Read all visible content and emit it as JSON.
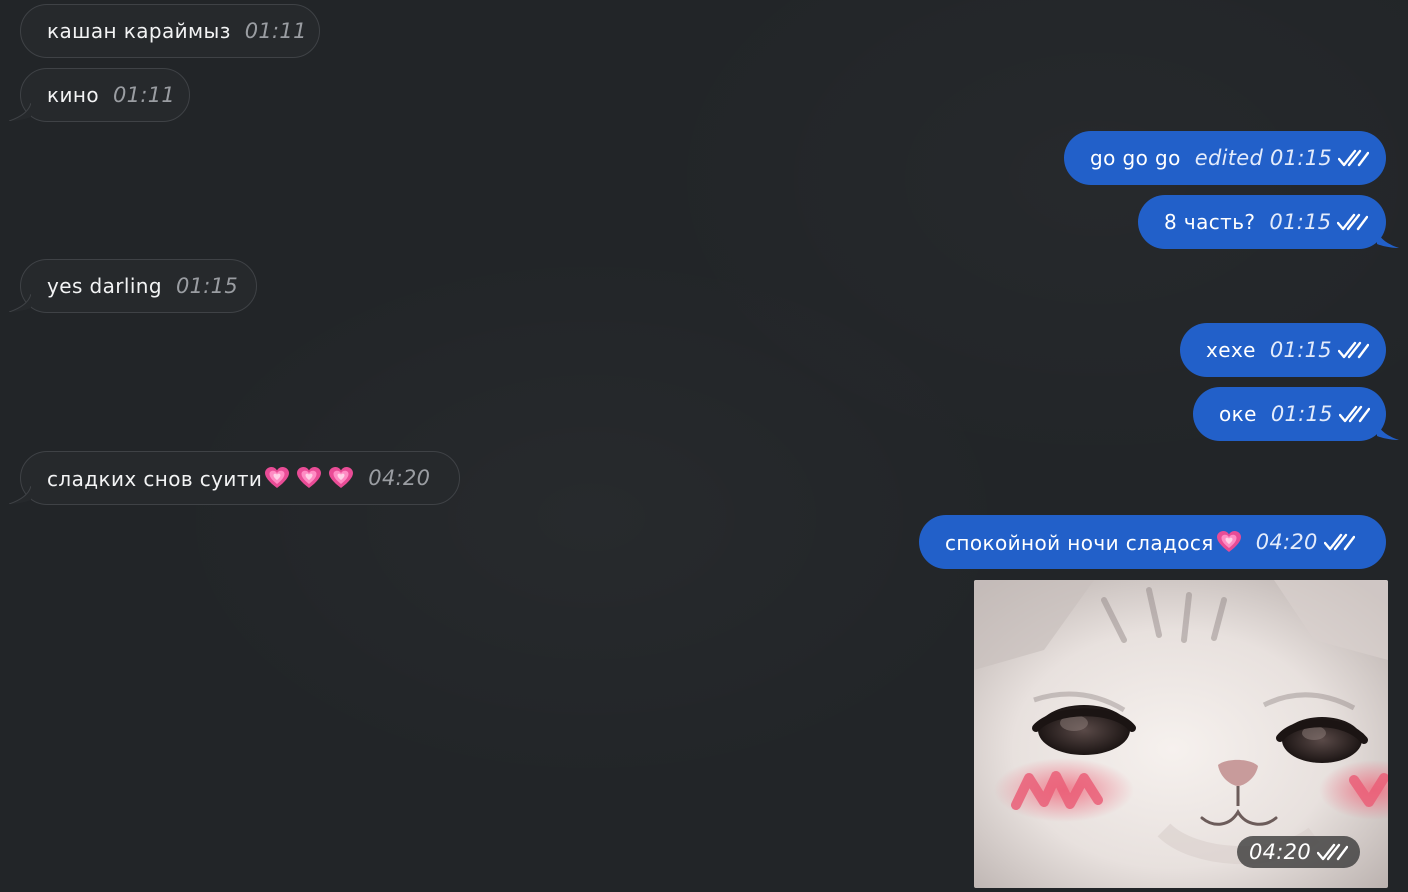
{
  "messages": [
    {
      "text": "кашан караймыз",
      "time": "01:11"
    },
    {
      "text": "кино",
      "time": "01:11"
    },
    {
      "text": "go go go",
      "time": "edited 01:15"
    },
    {
      "text": "8 часть?",
      "time": "01:15"
    },
    {
      "text": "yes darling",
      "time": "01:15"
    },
    {
      "text": "хехе",
      "time": "01:15"
    },
    {
      "text": "оке",
      "time": "01:15"
    },
    {
      "text": "сладких снов суити",
      "time": "04:20"
    },
    {
      "text": "спокойной ночи сладося",
      "time": "04:20"
    }
  ],
  "sticker": {
    "time": "04:20"
  },
  "icons": {
    "read_receipt": "double-check-icon",
    "emoji": "growing-heart-icon"
  },
  "colors": {
    "background": "#222528",
    "incoming_bubble": "#26292c",
    "outgoing_bubble": "#2260c9"
  }
}
